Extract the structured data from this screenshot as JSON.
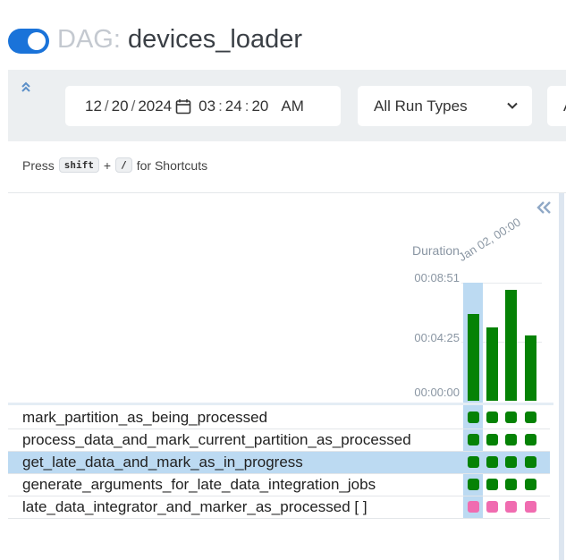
{
  "header": {
    "title_prefix": "DAG:",
    "dag_name": "devices_loader",
    "toggle_on": true
  },
  "filters": {
    "date": {
      "month": "12",
      "day": "20",
      "year": "2024",
      "hour": "03",
      "minute": "24",
      "second": "20",
      "ampm": "AM"
    },
    "run_type": "All Run Types",
    "next_select_partial": "A"
  },
  "shortcuts": {
    "press": "Press",
    "key1": "shift",
    "plus": "+",
    "key2": "/",
    "suffix": "for Shortcuts"
  },
  "grid": {
    "duration_label": "Duration",
    "run_date_label": "Jan 02, 00:00",
    "ticks": [
      "00:08:51",
      "00:04:25",
      "00:00:00"
    ],
    "y_max_seconds": 531,
    "run_durations_seconds": [
      390,
      330,
      497,
      293
    ],
    "bar_color": "#058205",
    "tasks": [
      {
        "name": "mark_partition_as_being_processed",
        "states": [
          "success",
          "success",
          "success",
          "success"
        ]
      },
      {
        "name": "process_data_and_mark_current_partition_as_processed",
        "states": [
          "success",
          "success",
          "success",
          "success"
        ]
      },
      {
        "name": "get_late_data_and_mark_as_in_progress",
        "states": [
          "success",
          "success",
          "success",
          "success"
        ],
        "highlighted": true
      },
      {
        "name": "generate_arguments_for_late_data_integration_jobs",
        "states": [
          "success",
          "success",
          "success",
          "success"
        ]
      },
      {
        "name": "late_data_integrator_and_marker_as_processed [ ]",
        "states": [
          "skipped",
          "skipped",
          "skipped",
          "skipped"
        ]
      }
    ],
    "state_colors": {
      "success": "#058205",
      "skipped": "#f06cb0"
    }
  }
}
